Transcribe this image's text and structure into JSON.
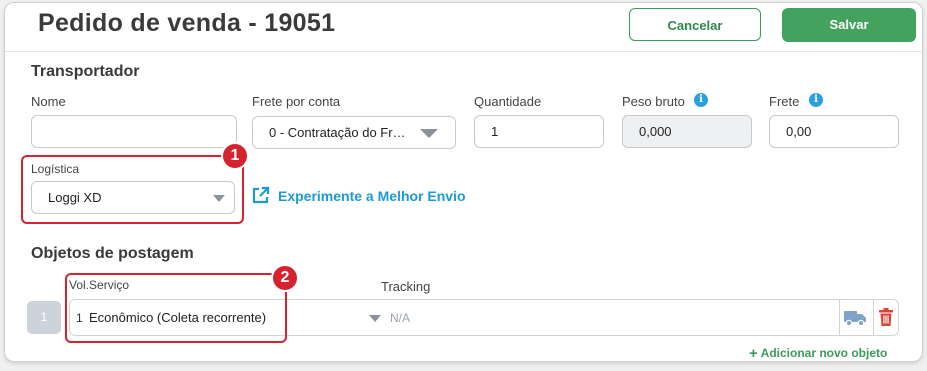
{
  "header": {
    "title": "Pedido de venda - 19051",
    "cancel_label": "Cancelar",
    "save_label": "Salvar"
  },
  "transportador": {
    "section_title": "Transportador",
    "nome_label": "Nome",
    "nome_value": "",
    "frete_conta_label": "Frete por conta",
    "frete_conta_value": "0 - Contratação do Fr…",
    "quantidade_label": "Quantidade",
    "quantidade_value": "1",
    "peso_label": "Peso bruto",
    "peso_value": "0,000",
    "frete_label": "Frete",
    "frete_value": "0,00",
    "logistica_label": "Logística",
    "logistica_value": "Loggi XD",
    "link_label": "Experimente a Melhor Envio"
  },
  "callouts": {
    "one": "1",
    "two": "2"
  },
  "objetos": {
    "section_title": "Objetos de postagem",
    "col_vol_servico": "Vol.Serviço",
    "col_tracking": "Tracking",
    "row_index": "1",
    "row_vol": "1",
    "row_servico": "Econômico (Coleta recorrente)",
    "row_tracking": "N/A",
    "add_label": "Adicionar novo objeto"
  },
  "colors": {
    "accent_green": "#43a25e",
    "highlight_red": "#d5222f",
    "link_blue": "#1c9ad6"
  },
  "icons": [
    "info-icon",
    "external-link-icon",
    "caret-down-icon",
    "truck-icon",
    "trash-icon",
    "plus-icon"
  ]
}
